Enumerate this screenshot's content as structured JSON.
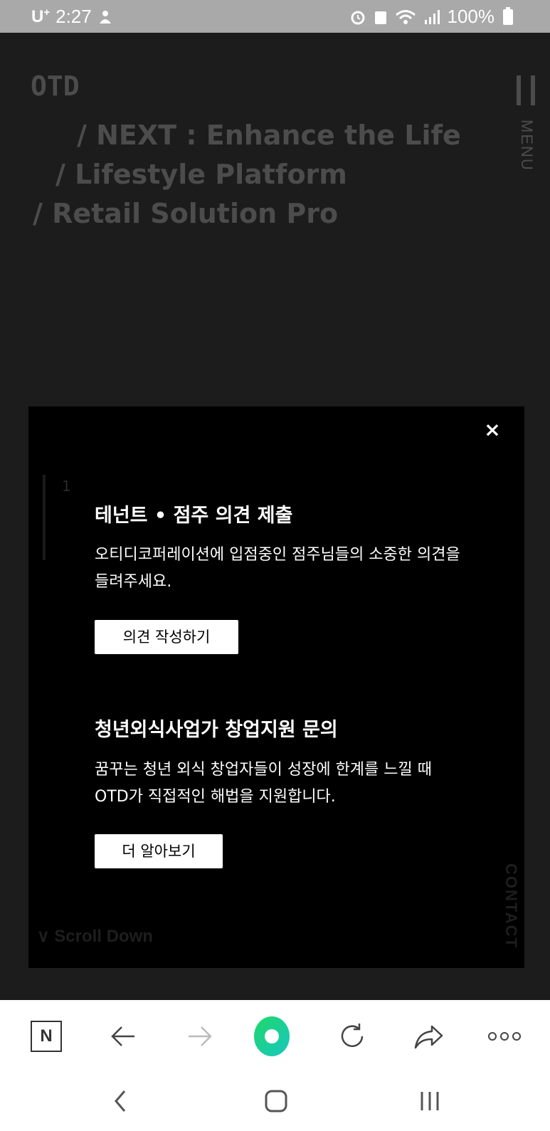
{
  "status_bar": {
    "carrier": "U",
    "carrier_sup": "+",
    "time": "2:27",
    "battery_percent": "100%"
  },
  "header": {
    "logo": "OTD",
    "taglines": [
      "/ NEXT : Enhance the Life",
      "/ Lifestyle Platform",
      "/ Retail Solution Pro"
    ],
    "menu_label": "MENU"
  },
  "modal": {
    "close_label": "×",
    "slide_number": "1",
    "sections": [
      {
        "title": "테넌트 • 점주 의견 제출",
        "description": "오티디코퍼레이션에 입점중인 점주님들의 소중한 의견을 들려주세요.",
        "button_label": "의견 작성하기"
      },
      {
        "title": "청년외식사업가 창업지원 문의",
        "description": "꿈꾸는 청년 외식 창업자들이 성장에 한계를 느낄 때 OTD가 직접적인 해법을 지원합니다.",
        "button_label": "더 알아보기"
      }
    ]
  },
  "background": {
    "scroll_down": "∨ Scroll Down",
    "contact_label": "CONTACT"
  },
  "browser_toolbar": {
    "n_label": "N"
  },
  "colors": {
    "accent_gradient_start": "#1fd86a",
    "accent_gradient_end": "#18c7c0",
    "modal_bg": "#000000",
    "page_bg": "#1c1c1c"
  }
}
